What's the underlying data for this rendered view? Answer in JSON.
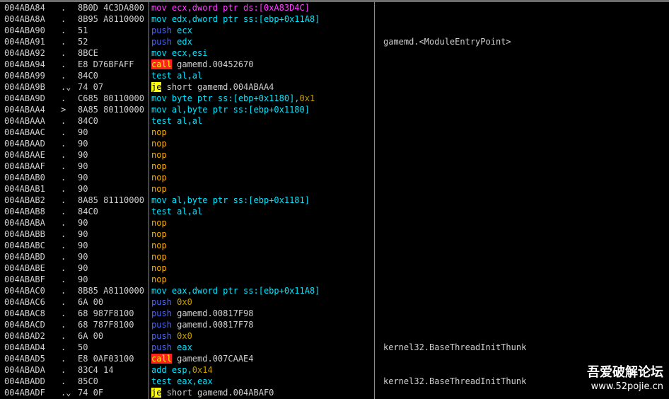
{
  "colors": {
    "background": "#000000",
    "text": "#d0d0d0",
    "mov": "#ff40ff",
    "push": "#4a66ff",
    "register": "#00e5ff",
    "call_bg": "#ff2020",
    "call_fg": "#ffff00",
    "jump_bg": "#ffff00",
    "jump_fg": "#000000",
    "test": "#00e5ff",
    "nop": "#ffb000",
    "immediate": "#c8a000",
    "memory_highlight": "#ff40ff"
  },
  "rows": [
    {
      "addr": "004ABA84",
      "mark": ".",
      "bytes": "8B0D 4C3DA800",
      "parts": [
        {
          "t": "mov ecx,dword ptr ds:[0xA83D4C]",
          "c": "mov"
        }
      ],
      "cmt": ""
    },
    {
      "addr": "004ABA8A",
      "mark": ".",
      "bytes": "8B95 A8110000",
      "parts": [
        {
          "t": "mov edx,dword ptr ss:[ebp+0x11A8]",
          "c": "reg"
        }
      ],
      "cmt": ""
    },
    {
      "addr": "004ABA90",
      "mark": ".",
      "bytes": "51",
      "parts": [
        {
          "t": "push ",
          "c": "push"
        },
        {
          "t": "ecx",
          "c": "reg"
        }
      ],
      "cmt": ""
    },
    {
      "addr": "004ABA91",
      "mark": ".",
      "bytes": "52",
      "parts": [
        {
          "t": "push ",
          "c": "push"
        },
        {
          "t": "edx",
          "c": "reg"
        }
      ],
      "cmt": "gamemd.<ModuleEntryPoint>"
    },
    {
      "addr": "004ABA92",
      "mark": ".",
      "bytes": "8BCE",
      "parts": [
        {
          "t": "mov ",
          "c": "reg"
        },
        {
          "t": "ecx,esi",
          "c": "reg"
        }
      ],
      "cmt": ""
    },
    {
      "addr": "004ABA94",
      "mark": ".",
      "bytes": "E8 D76BFAFF",
      "parts": [
        {
          "t": "call",
          "c": "call"
        },
        {
          "t": " gamemd.00452670",
          "c": "plain"
        }
      ],
      "cmt": ""
    },
    {
      "addr": "004ABA99",
      "mark": ".",
      "bytes": "84C0",
      "parts": [
        {
          "t": "test al,al",
          "c": "reg"
        }
      ],
      "cmt": ""
    },
    {
      "addr": "004ABA9B",
      "mark": ".⌄",
      "bytes": "74 07",
      "parts": [
        {
          "t": "je",
          "c": "jump"
        },
        {
          "t": " short gamemd.004ABAA4",
          "c": "plain"
        }
      ],
      "cmt": ""
    },
    {
      "addr": "004ABA9D",
      "mark": ".",
      "bytes": "C685 80110000",
      "parts": [
        {
          "t": "mov byte ptr ss:[ebp+0x1180],",
          "c": "reg"
        },
        {
          "t": "0x1",
          "c": "imm"
        }
      ],
      "cmt": ""
    },
    {
      "addr": "004ABAA4",
      "mark": ">",
      "bytes": "8A85 80110000",
      "parts": [
        {
          "t": "mov al,byte ptr ss:[ebp+0x1180]",
          "c": "reg"
        }
      ],
      "cmt": ""
    },
    {
      "addr": "004ABAAA",
      "mark": ".",
      "bytes": "84C0",
      "parts": [
        {
          "t": "test al,al",
          "c": "reg"
        }
      ],
      "cmt": ""
    },
    {
      "addr": "004ABAAC",
      "mark": ".",
      "bytes": "90",
      "parts": [
        {
          "t": "nop",
          "c": "nop"
        }
      ],
      "cmt": ""
    },
    {
      "addr": "004ABAAD",
      "mark": ".",
      "bytes": "90",
      "parts": [
        {
          "t": "nop",
          "c": "nop"
        }
      ],
      "cmt": ""
    },
    {
      "addr": "004ABAAE",
      "mark": ".",
      "bytes": "90",
      "parts": [
        {
          "t": "nop",
          "c": "nop"
        }
      ],
      "cmt": ""
    },
    {
      "addr": "004ABAAF",
      "mark": ".",
      "bytes": "90",
      "parts": [
        {
          "t": "nop",
          "c": "nop"
        }
      ],
      "cmt": ""
    },
    {
      "addr": "004ABAB0",
      "mark": ".",
      "bytes": "90",
      "parts": [
        {
          "t": "nop",
          "c": "nop"
        }
      ],
      "cmt": ""
    },
    {
      "addr": "004ABAB1",
      "mark": ".",
      "bytes": "90",
      "parts": [
        {
          "t": "nop",
          "c": "nop"
        }
      ],
      "cmt": ""
    },
    {
      "addr": "004ABAB2",
      "mark": ".",
      "bytes": "8A85 81110000",
      "parts": [
        {
          "t": "mov al,byte ptr ss:[ebp+0x1181]",
          "c": "reg"
        }
      ],
      "cmt": ""
    },
    {
      "addr": "004ABAB8",
      "mark": ".",
      "bytes": "84C0",
      "parts": [
        {
          "t": "test al,al",
          "c": "reg"
        }
      ],
      "cmt": ""
    },
    {
      "addr": "004ABABA",
      "mark": ".",
      "bytes": "90",
      "parts": [
        {
          "t": "nop",
          "c": "nop"
        }
      ],
      "cmt": ""
    },
    {
      "addr": "004ABABB",
      "mark": ".",
      "bytes": "90",
      "parts": [
        {
          "t": "nop",
          "c": "nop"
        }
      ],
      "cmt": ""
    },
    {
      "addr": "004ABABC",
      "mark": ".",
      "bytes": "90",
      "parts": [
        {
          "t": "nop",
          "c": "nop"
        }
      ],
      "cmt": ""
    },
    {
      "addr": "004ABABD",
      "mark": ".",
      "bytes": "90",
      "parts": [
        {
          "t": "nop",
          "c": "nop"
        }
      ],
      "cmt": ""
    },
    {
      "addr": "004ABABE",
      "mark": ".",
      "bytes": "90",
      "parts": [
        {
          "t": "nop",
          "c": "nop"
        }
      ],
      "cmt": ""
    },
    {
      "addr": "004ABABF",
      "mark": ".",
      "bytes": "90",
      "parts": [
        {
          "t": "nop",
          "c": "nop"
        }
      ],
      "cmt": ""
    },
    {
      "addr": "004ABAC0",
      "mark": ".",
      "bytes": "8B85 A8110000",
      "parts": [
        {
          "t": "mov eax,dword ptr ss:[ebp+0x11A8]",
          "c": "reg"
        }
      ],
      "cmt": ""
    },
    {
      "addr": "004ABAC6",
      "mark": ".",
      "bytes": "6A 00",
      "parts": [
        {
          "t": "push ",
          "c": "push"
        },
        {
          "t": "0x0",
          "c": "imm"
        }
      ],
      "cmt": ""
    },
    {
      "addr": "004ABAC8",
      "mark": ".",
      "bytes": "68 987F8100",
      "parts": [
        {
          "t": "push ",
          "c": "push"
        },
        {
          "t": "gamemd.00817F98",
          "c": "plain"
        }
      ],
      "cmt": ""
    },
    {
      "addr": "004ABACD",
      "mark": ".",
      "bytes": "68 787F8100",
      "parts": [
        {
          "t": "push ",
          "c": "push"
        },
        {
          "t": "gamemd.00817F78",
          "c": "plain"
        }
      ],
      "cmt": ""
    },
    {
      "addr": "004ABAD2",
      "mark": ".",
      "bytes": "6A 00",
      "parts": [
        {
          "t": "push ",
          "c": "push"
        },
        {
          "t": "0x0",
          "c": "imm"
        }
      ],
      "cmt": ""
    },
    {
      "addr": "004ABAD4",
      "mark": ".",
      "bytes": "50",
      "parts": [
        {
          "t": "push ",
          "c": "push"
        },
        {
          "t": "eax",
          "c": "reg"
        }
      ],
      "cmt": "kernel32.BaseThreadInitThunk"
    },
    {
      "addr": "004ABAD5",
      "mark": ".",
      "bytes": "E8 0AF03100",
      "parts": [
        {
          "t": "call",
          "c": "call"
        },
        {
          "t": " gamemd.007CAAE4",
          "c": "plain"
        }
      ],
      "cmt": ""
    },
    {
      "addr": "004ABADA",
      "mark": ".",
      "bytes": "83C4 14",
      "parts": [
        {
          "t": "add esp,",
          "c": "reg"
        },
        {
          "t": "0x14",
          "c": "imm"
        }
      ],
      "cmt": ""
    },
    {
      "addr": "004ABADD",
      "mark": ".",
      "bytes": "85C0",
      "parts": [
        {
          "t": "test eax,eax",
          "c": "reg"
        }
      ],
      "cmt": "kernel32.BaseThreadInitThunk"
    },
    {
      "addr": "004ABADF",
      "mark": ".⌄",
      "bytes": "74 0F",
      "parts": [
        {
          "t": "je",
          "c": "jump"
        },
        {
          "t": " short gamemd.004ABAF0",
          "c": "plain"
        }
      ],
      "cmt": ""
    }
  ],
  "watermark": {
    "title": "吾爱破解论坛",
    "url": "www.52pojie.cn"
  }
}
